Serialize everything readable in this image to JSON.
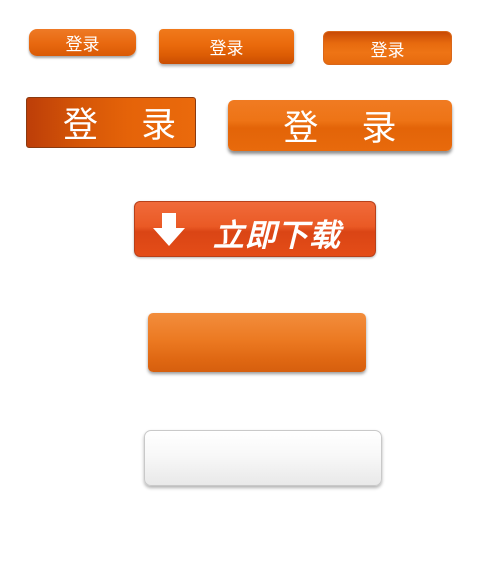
{
  "buttons": {
    "login_small_rounded": "登录",
    "login_small_flat": "登录",
    "login_small_outlined": "登录",
    "login_large_flat": "登 录",
    "login_large_glossy": "登 录",
    "download": {
      "label": "立即下载",
      "icon": "download-arrow-icon"
    },
    "blank_orange": "",
    "blank_white": ""
  },
  "colors": {
    "orange_primary": "#e8680f",
    "download_red_orange": "#e44d18",
    "white_button": "#f2f2f2"
  }
}
